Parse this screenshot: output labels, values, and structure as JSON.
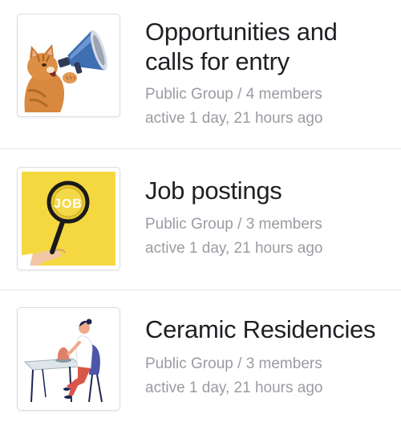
{
  "groups": [
    {
      "title_line1": "Opportunities and",
      "title_line2": "calls for entry",
      "visibility": "Public Group",
      "separator": " / ",
      "members": "4 members",
      "activity": "active 1 day, 21 hours ago",
      "image": "cat-with-megaphone-image"
    },
    {
      "title_line1": "Job postings",
      "visibility": "Public Group",
      "separator": " / ",
      "members": "3 members",
      "activity": "active 1 day, 21 hours ago",
      "image": "magnifying-glass-job-image",
      "image_text": "JOB",
      "image_background": "#f5d83f"
    },
    {
      "title_line1": "Ceramic Residencies",
      "visibility": "Public Group",
      "separator": " / ",
      "members": "3 members",
      "activity": "active 1 day, 21 hours ago",
      "image": "potter-at-wheel-illustration"
    }
  ],
  "colors": {
    "title": "#1f2024",
    "meta": "#9b9ca3",
    "divider": "#e7e7e9"
  }
}
